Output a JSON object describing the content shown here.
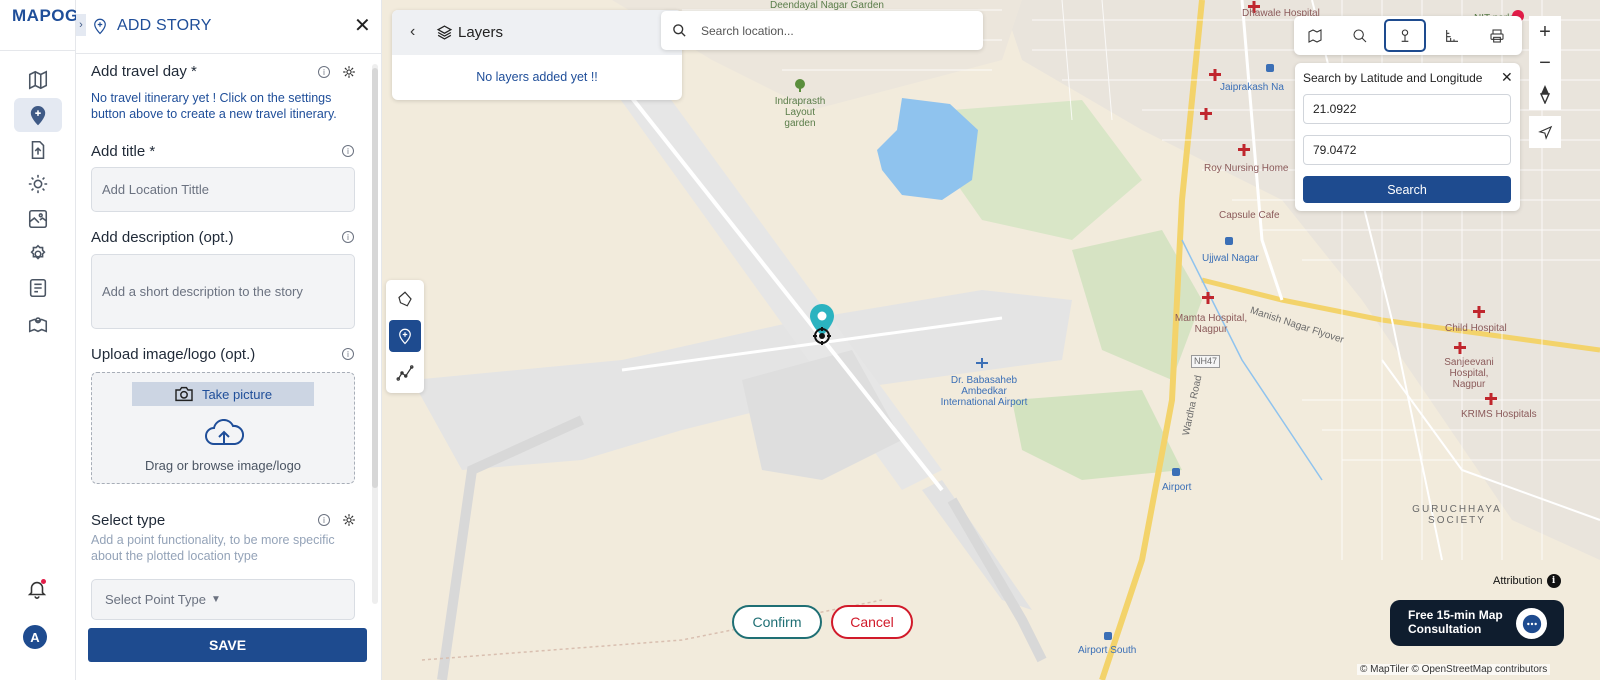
{
  "app": {
    "logo": "MAPOG"
  },
  "rail": {
    "items": [
      {
        "name": "map-icon"
      },
      {
        "name": "add-story-icon",
        "active": true
      },
      {
        "name": "upload-icon"
      },
      {
        "name": "settings-sun-icon"
      },
      {
        "name": "map-gallery-icon"
      },
      {
        "name": "gear-icon"
      },
      {
        "name": "checklist-icon"
      },
      {
        "name": "location-map-icon"
      }
    ],
    "avatar_initial": "A"
  },
  "panel": {
    "title": "ADD STORY",
    "travel_day_label": "Add travel day *",
    "travel_day_hint": "No travel itinerary yet ! Click on the settings button above to create a new travel itinerary.",
    "title_label": "Add title *",
    "title_placeholder": "Add Location Tittle",
    "description_label": "Add description (opt.)",
    "description_placeholder": "Add a short description to the story",
    "upload_label": "Upload image/logo (opt.)",
    "take_picture": "Take picture",
    "drag_text": "Drag or browse image/logo",
    "select_type_label": "Select type",
    "select_type_hint": "Add a point functionality, to be more specific about the plotted location type",
    "select_point_type": "Select Point Type",
    "save": "SAVE"
  },
  "layers": {
    "title": "Layers",
    "empty": "No layers added yet !!"
  },
  "search": {
    "placeholder": "Search location..."
  },
  "latlng": {
    "title": "Search by Latitude and Longitude",
    "latitude": "21.0922",
    "longitude": "79.0472",
    "search": "Search"
  },
  "actions": {
    "confirm": "Confirm",
    "cancel": "Cancel"
  },
  "map_labels": {
    "deendayal": "Deendayal Nagar Garden",
    "dhawale": "Dhawale Hospital",
    "nit": "NIT park",
    "jaiprakash": "Jaiprakash Na",
    "indraprasth": "Indraprasth Layout garden",
    "roy": "Roy Nursing Home",
    "capsule": "Capsule Cafe",
    "ujjwal": "Ujjwal Nagar",
    "mamta": "Mamta Hospital, Nagpur",
    "manish": "Manish Nagar Flyover",
    "child": "Child Hospital",
    "sanjeevani": "Sanjeevani Hospital, Nagpur",
    "krims": "KRIMS Hospitals",
    "nh47": "NH47",
    "wardha": "Wardha Road",
    "airport_intl": "Dr. Babasaheb Ambedkar International Airport",
    "airport": "Airport",
    "airport_south": "Airport South",
    "guruchhaya": "GURUCHHAYA SOCIETY",
    "letter_n": "N"
  },
  "attribution": "Attribution",
  "copyright": "© MapTiler © OpenStreetMap contributors",
  "consult": {
    "text": "Free 15-min Map Consultation"
  },
  "colors": {
    "brand": "#1e4b8f",
    "confirm": "#1f6f74",
    "cancel": "#d11a2a",
    "marker": "#2bb3c0"
  }
}
